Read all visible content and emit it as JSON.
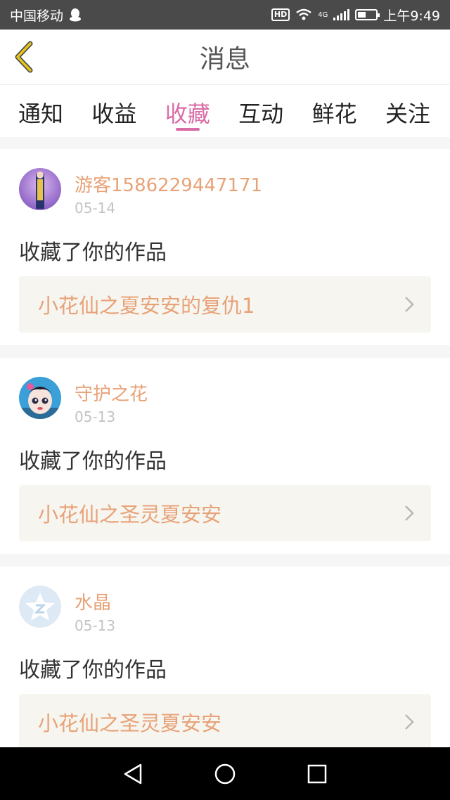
{
  "status_bar": {
    "carrier": "中国移动",
    "network": "4G",
    "hd_badge": "HD",
    "time": "上午9:49",
    "battery_level": 0.45
  },
  "header": {
    "title": "消息"
  },
  "tabs": [
    {
      "label": "通知"
    },
    {
      "label": "收益"
    },
    {
      "label": "收藏",
      "active": true
    },
    {
      "label": "互动"
    },
    {
      "label": "鲜花"
    },
    {
      "label": "关注"
    }
  ],
  "items": [
    {
      "user": "游客1586229447171",
      "date": "05-14",
      "action": "收藏了你的作品",
      "work": "小花仙之夏安安的复仇1",
      "avatar": "avatar-purple-figure"
    },
    {
      "user": "守护之花",
      "date": "05-13",
      "action": "收藏了你的作品",
      "work": "小花仙之圣灵夏安安",
      "avatar": "avatar-cartoon-girl"
    },
    {
      "user": "水晶",
      "date": "05-13",
      "action": "收藏了你的作品",
      "work": "小花仙之圣灵夏安安",
      "avatar": "avatar-qzone-default"
    }
  ],
  "colors": {
    "accent": "#d96ca6",
    "username": "#e8a277",
    "back_arrow": "#e6c619"
  }
}
